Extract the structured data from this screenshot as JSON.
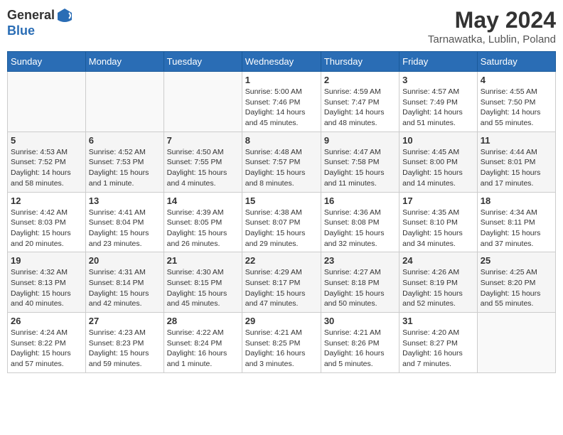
{
  "header": {
    "logo_line1": "General",
    "logo_line2": "Blue",
    "month_year": "May 2024",
    "location": "Tarnawatka, Lublin, Poland"
  },
  "days_of_week": [
    "Sunday",
    "Monday",
    "Tuesday",
    "Wednesday",
    "Thursday",
    "Friday",
    "Saturday"
  ],
  "weeks": [
    [
      {
        "day": "",
        "info": ""
      },
      {
        "day": "",
        "info": ""
      },
      {
        "day": "",
        "info": ""
      },
      {
        "day": "1",
        "info": "Sunrise: 5:00 AM\nSunset: 7:46 PM\nDaylight: 14 hours\nand 45 minutes."
      },
      {
        "day": "2",
        "info": "Sunrise: 4:59 AM\nSunset: 7:47 PM\nDaylight: 14 hours\nand 48 minutes."
      },
      {
        "day": "3",
        "info": "Sunrise: 4:57 AM\nSunset: 7:49 PM\nDaylight: 14 hours\nand 51 minutes."
      },
      {
        "day": "4",
        "info": "Sunrise: 4:55 AM\nSunset: 7:50 PM\nDaylight: 14 hours\nand 55 minutes."
      }
    ],
    [
      {
        "day": "5",
        "info": "Sunrise: 4:53 AM\nSunset: 7:52 PM\nDaylight: 14 hours\nand 58 minutes."
      },
      {
        "day": "6",
        "info": "Sunrise: 4:52 AM\nSunset: 7:53 PM\nDaylight: 15 hours\nand 1 minute."
      },
      {
        "day": "7",
        "info": "Sunrise: 4:50 AM\nSunset: 7:55 PM\nDaylight: 15 hours\nand 4 minutes."
      },
      {
        "day": "8",
        "info": "Sunrise: 4:48 AM\nSunset: 7:57 PM\nDaylight: 15 hours\nand 8 minutes."
      },
      {
        "day": "9",
        "info": "Sunrise: 4:47 AM\nSunset: 7:58 PM\nDaylight: 15 hours\nand 11 minutes."
      },
      {
        "day": "10",
        "info": "Sunrise: 4:45 AM\nSunset: 8:00 PM\nDaylight: 15 hours\nand 14 minutes."
      },
      {
        "day": "11",
        "info": "Sunrise: 4:44 AM\nSunset: 8:01 PM\nDaylight: 15 hours\nand 17 minutes."
      }
    ],
    [
      {
        "day": "12",
        "info": "Sunrise: 4:42 AM\nSunset: 8:03 PM\nDaylight: 15 hours\nand 20 minutes."
      },
      {
        "day": "13",
        "info": "Sunrise: 4:41 AM\nSunset: 8:04 PM\nDaylight: 15 hours\nand 23 minutes."
      },
      {
        "day": "14",
        "info": "Sunrise: 4:39 AM\nSunset: 8:05 PM\nDaylight: 15 hours\nand 26 minutes."
      },
      {
        "day": "15",
        "info": "Sunrise: 4:38 AM\nSunset: 8:07 PM\nDaylight: 15 hours\nand 29 minutes."
      },
      {
        "day": "16",
        "info": "Sunrise: 4:36 AM\nSunset: 8:08 PM\nDaylight: 15 hours\nand 32 minutes."
      },
      {
        "day": "17",
        "info": "Sunrise: 4:35 AM\nSunset: 8:10 PM\nDaylight: 15 hours\nand 34 minutes."
      },
      {
        "day": "18",
        "info": "Sunrise: 4:34 AM\nSunset: 8:11 PM\nDaylight: 15 hours\nand 37 minutes."
      }
    ],
    [
      {
        "day": "19",
        "info": "Sunrise: 4:32 AM\nSunset: 8:13 PM\nDaylight: 15 hours\nand 40 minutes."
      },
      {
        "day": "20",
        "info": "Sunrise: 4:31 AM\nSunset: 8:14 PM\nDaylight: 15 hours\nand 42 minutes."
      },
      {
        "day": "21",
        "info": "Sunrise: 4:30 AM\nSunset: 8:15 PM\nDaylight: 15 hours\nand 45 minutes."
      },
      {
        "day": "22",
        "info": "Sunrise: 4:29 AM\nSunset: 8:17 PM\nDaylight: 15 hours\nand 47 minutes."
      },
      {
        "day": "23",
        "info": "Sunrise: 4:27 AM\nSunset: 8:18 PM\nDaylight: 15 hours\nand 50 minutes."
      },
      {
        "day": "24",
        "info": "Sunrise: 4:26 AM\nSunset: 8:19 PM\nDaylight: 15 hours\nand 52 minutes."
      },
      {
        "day": "25",
        "info": "Sunrise: 4:25 AM\nSunset: 8:20 PM\nDaylight: 15 hours\nand 55 minutes."
      }
    ],
    [
      {
        "day": "26",
        "info": "Sunrise: 4:24 AM\nSunset: 8:22 PM\nDaylight: 15 hours\nand 57 minutes."
      },
      {
        "day": "27",
        "info": "Sunrise: 4:23 AM\nSunset: 8:23 PM\nDaylight: 15 hours\nand 59 minutes."
      },
      {
        "day": "28",
        "info": "Sunrise: 4:22 AM\nSunset: 8:24 PM\nDaylight: 16 hours\nand 1 minute."
      },
      {
        "day": "29",
        "info": "Sunrise: 4:21 AM\nSunset: 8:25 PM\nDaylight: 16 hours\nand 3 minutes."
      },
      {
        "day": "30",
        "info": "Sunrise: 4:21 AM\nSunset: 8:26 PM\nDaylight: 16 hours\nand 5 minutes."
      },
      {
        "day": "31",
        "info": "Sunrise: 4:20 AM\nSunset: 8:27 PM\nDaylight: 16 hours\nand 7 minutes."
      },
      {
        "day": "",
        "info": ""
      }
    ]
  ]
}
